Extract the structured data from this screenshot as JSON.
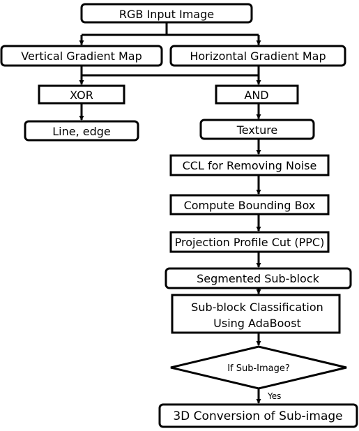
{
  "nodes": {
    "rgb": "RGB Input Image",
    "vertical": "Vertical Gradient Map",
    "horizontal": "Horizontal Gradient Map",
    "xor": "XOR",
    "and": "AND",
    "line_edge": "Line, edge",
    "texture": "Texture",
    "ccl": "CCL for Removing Noise",
    "bbox": "Compute Bounding Box",
    "ppc": "Projection Profile Cut (PPC)",
    "segmented": "Segmented Sub-block",
    "classification_line1": "Sub-block Classification",
    "classification_line2": "Using AdaBoost",
    "decision": "If Sub-Image?",
    "conversion": "3D Conversion of Sub-image"
  },
  "edges": {
    "yes_label": "Yes"
  }
}
